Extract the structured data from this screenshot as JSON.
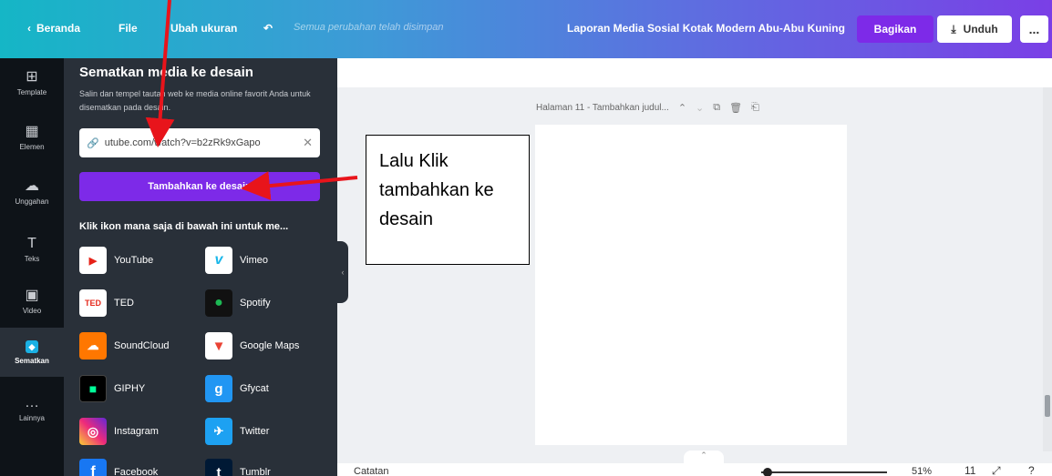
{
  "topbar": {
    "back_label": "Beranda",
    "file_label": "File",
    "resize_label": "Ubah ukuran",
    "saved_status": "Semua perubahan telah disimpan",
    "doc_title": "Laporan Media Sosial Kotak Modern Abu-Abu Kuning",
    "share_label": "Bagikan",
    "download_label": "Unduh",
    "more_label": "..."
  },
  "rail": {
    "items": [
      {
        "label": "Template",
        "icon": "template-icon"
      },
      {
        "label": "Elemen",
        "icon": "elements-icon"
      },
      {
        "label": "Unggahan",
        "icon": "upload-icon"
      },
      {
        "label": "Teks",
        "icon": "text-icon"
      },
      {
        "label": "Video",
        "icon": "video-icon"
      },
      {
        "label": "Sematkan",
        "icon": "embed-icon"
      },
      {
        "label": "Lainnya",
        "icon": "more-icon"
      }
    ],
    "active": "Sematkan"
  },
  "panel": {
    "title": "Sematkan media ke desain",
    "description": "Salin dan tempel tautan web ke media online favorit Anda untuk disematkan pada desain.",
    "url_value": "utube.com/watch?v=b2zRk9xGapo",
    "add_button": "Tambahkan ke desain",
    "hint": "Klik ikon mana saja di bawah ini untuk me...",
    "services": [
      {
        "name": "YouTube",
        "color": "#e62117"
      },
      {
        "name": "Vimeo",
        "color": "#ffffff"
      },
      {
        "name": "TED",
        "color": "#e62b1e"
      },
      {
        "name": "Spotify",
        "color": "#1db954"
      },
      {
        "name": "SoundCloud",
        "color": "#ff7700"
      },
      {
        "name": "Google Maps",
        "color": "#ffffff"
      },
      {
        "name": "GIPHY",
        "color": "#000000"
      },
      {
        "name": "Gfycat",
        "color": "#2196f3"
      },
      {
        "name": "Instagram",
        "color": "#c13584"
      },
      {
        "name": "Twitter",
        "color": "#1da1f2"
      },
      {
        "name": "Facebook",
        "color": "#1877f2"
      },
      {
        "name": "Tumblr",
        "color": "#001935"
      }
    ]
  },
  "canvas": {
    "page_label": "Halaman 11 - Tambahkan judul..."
  },
  "bottombar": {
    "notes_label": "Catatan",
    "zoom": "51%",
    "page_count": "11"
  },
  "annotation": {
    "callout_text": "Lalu Klik tambahkan ke desain",
    "color": "#e8141b"
  },
  "colors": {
    "accent_purple": "#7d2ae8",
    "panel_bg": "#293039",
    "rail_bg": "#0e1318"
  }
}
